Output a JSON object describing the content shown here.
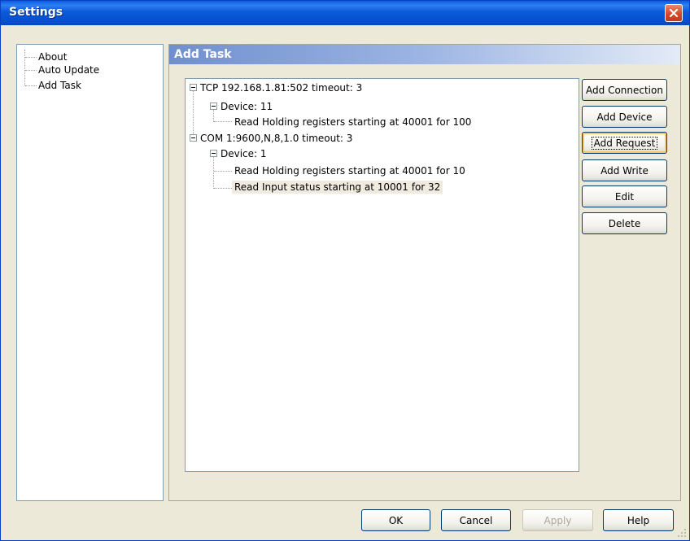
{
  "window": {
    "title": "Settings"
  },
  "nav": {
    "items": [
      "About",
      "Auto Update",
      "Add Task"
    ]
  },
  "panel": {
    "title": "Add Task"
  },
  "tree": {
    "connections": [
      {
        "label": "TCP 192.168.1.81:502 timeout: 3",
        "devices": [
          {
            "label": "Device: 11",
            "requests": [
              "Read Holding registers starting at 40001 for 100"
            ]
          }
        ]
      },
      {
        "label": "COM 1:9600,N,8,1.0 timeout: 3",
        "devices": [
          {
            "label": "Device: 1",
            "requests": [
              "Read Holding registers starting at 40001 for 10",
              "Read Input status starting at 10001 for 32"
            ]
          }
        ]
      }
    ],
    "selected": "Read Input status starting at 10001 for 32"
  },
  "actions": {
    "add_connection": "Add Connection",
    "add_device": "Add Device",
    "add_request": "Add Request",
    "add_write": "Add Write",
    "edit": "Edit",
    "delete": "Delete"
  },
  "footer": {
    "ok": "OK",
    "cancel": "Cancel",
    "apply": "Apply",
    "help": "Help"
  },
  "icons": {
    "close": "close-icon",
    "resize": "resize-grip-icon"
  },
  "colors": {
    "titlebar": "#0a5ad9",
    "dialog_bg": "#ece9d8",
    "close_button": "#d9462a",
    "button_border": "#003c74"
  }
}
